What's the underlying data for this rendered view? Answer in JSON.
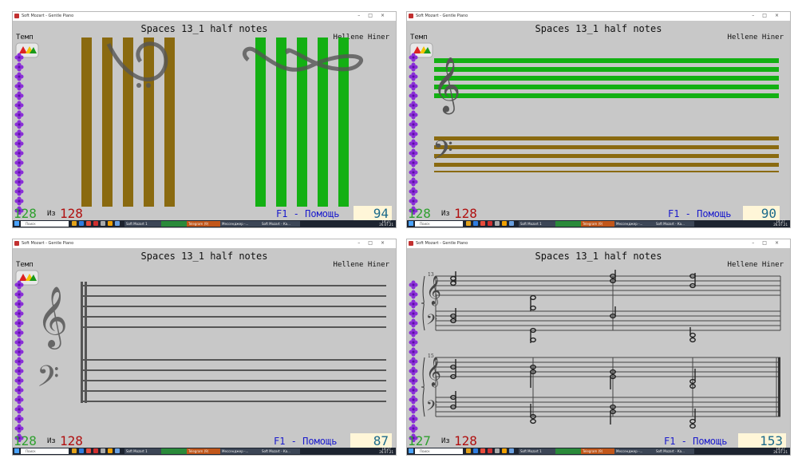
{
  "window_title": "Soft Mozart - Gentle Piano",
  "song_title": "Spaces 13_1 half notes",
  "composer": "Hellene Hiner",
  "tempo_label": "Темп",
  "of_label": "Из",
  "help_label": "F1 - Помощь",
  "search_placeholder": "Поиск",
  "app_tab_label": "Soft Mozart 1",
  "taskbar_tab_2": "Telegram (9)",
  "taskbar_tab_3": "Мессенджер -...",
  "taskbar_tab_4": "Soft Mozart - Ка...",
  "clock_time": "14:27",
  "clock_date": "26.07.21",
  "panels": [
    {
      "id": "tl",
      "current": "128",
      "total": "128",
      "score": "94",
      "view": "vertical-bars"
    },
    {
      "id": "tr",
      "current": "128",
      "total": "128",
      "score": "90",
      "view": "horizontal-bars"
    },
    {
      "id": "bl",
      "current": "128",
      "total": "128",
      "score": "87",
      "view": "empty-staff"
    },
    {
      "id": "br",
      "current": "127",
      "total": "128",
      "score": "153",
      "view": "sheet-music",
      "measure_numbers": [
        "13",
        "15"
      ]
    }
  ],
  "colors": {
    "green": "#13b013",
    "brown": "#8a6a10",
    "window_bg": "#c8c8c8",
    "help_blue": "#1a1acc",
    "score_blue": "#1a6a8a",
    "count_green": "#2fa02f",
    "count_red": "#b01010",
    "flower_purple": "#8a2fd8"
  }
}
